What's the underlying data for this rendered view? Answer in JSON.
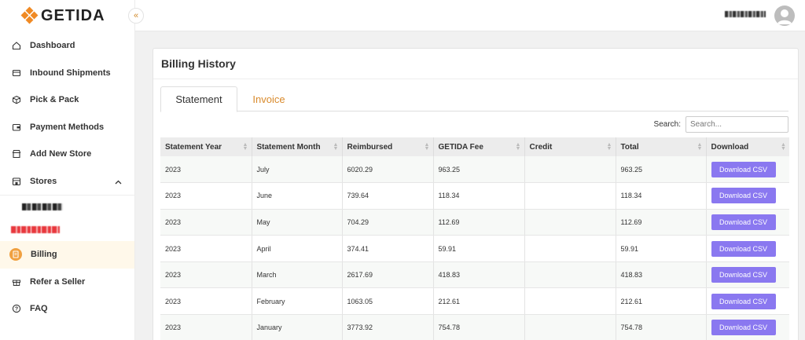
{
  "brand": {
    "name": "GETIDA",
    "accent": "#f08a24"
  },
  "sidebar": {
    "collapse_label": "«",
    "items": [
      {
        "label": "Dashboard",
        "icon": "home-icon"
      },
      {
        "label": "Inbound Shipments",
        "icon": "truck-icon"
      },
      {
        "label": "Pick & Pack",
        "icon": "box-icon"
      },
      {
        "label": "Payment Methods",
        "icon": "wallet-icon"
      },
      {
        "label": "Add New Store",
        "icon": "store-icon"
      },
      {
        "label": "Stores",
        "icon": "stores-icon",
        "expanded": true
      },
      {
        "label": "Billing",
        "icon": "billing-icon",
        "active": true
      },
      {
        "label": "Refer a Seller",
        "icon": "gift-icon"
      },
      {
        "label": "FAQ",
        "icon": "question-icon"
      }
    ]
  },
  "page": {
    "title": "Billing History",
    "tabs": [
      {
        "label": "Statement",
        "active": true
      },
      {
        "label": "Invoice",
        "active": false
      }
    ],
    "search": {
      "label": "Search:",
      "placeholder": "Search..."
    },
    "table": {
      "columns": [
        "Statement Year",
        "Statement Month",
        "Reimbursed",
        "GETIDA Fee",
        "Credit",
        "Total",
        "Download"
      ],
      "rows": [
        {
          "year": "2023",
          "month": "July",
          "reimbursed": "6020.29",
          "fee": "963.25",
          "credit": "",
          "total": "963.25",
          "download": "Download CSV"
        },
        {
          "year": "2023",
          "month": "June",
          "reimbursed": "739.64",
          "fee": "118.34",
          "credit": "",
          "total": "118.34",
          "download": "Download CSV"
        },
        {
          "year": "2023",
          "month": "May",
          "reimbursed": "704.29",
          "fee": "112.69",
          "credit": "",
          "total": "112.69",
          "download": "Download CSV"
        },
        {
          "year": "2023",
          "month": "April",
          "reimbursed": "374.41",
          "fee": "59.91",
          "credit": "",
          "total": "59.91",
          "download": "Download CSV"
        },
        {
          "year": "2023",
          "month": "March",
          "reimbursed": "2617.69",
          "fee": "418.83",
          "credit": "",
          "total": "418.83",
          "download": "Download CSV"
        },
        {
          "year": "2023",
          "month": "February",
          "reimbursed": "1063.05",
          "fee": "212.61",
          "credit": "",
          "total": "212.61",
          "download": "Download CSV"
        },
        {
          "year": "2023",
          "month": "January",
          "reimbursed": "3773.92",
          "fee": "754.78",
          "credit": "",
          "total": "754.78",
          "download": "Download CSV"
        }
      ]
    }
  },
  "colors": {
    "accent": "#f08a24",
    "tab_inactive": "#d98a2c",
    "button": "#8a78f0",
    "active_bg": "#fff8ea"
  }
}
